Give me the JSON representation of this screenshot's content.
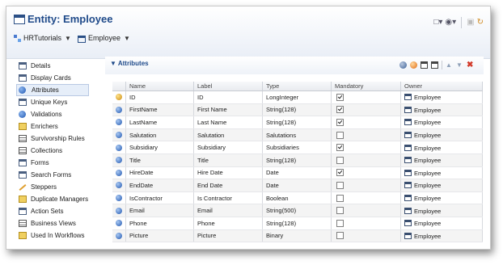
{
  "window": {
    "title": "Entity: Employee"
  },
  "breadcrumb": [
    {
      "label": "HRTutorials",
      "icon": "tree-icon"
    },
    {
      "label": "Employee",
      "icon": "entity-icon"
    }
  ],
  "toolbar": {
    "icons": [
      "new-dropdown-icon",
      "binoculars-dropdown-icon",
      "save-icon",
      "refresh-icon"
    ]
  },
  "sidebar": {
    "items": [
      {
        "label": "Details",
        "icon": "details-icon"
      },
      {
        "label": "Display Cards",
        "icon": "display-cards-icon"
      },
      {
        "label": "Attributes",
        "icon": "attributes-icon",
        "selected": true
      },
      {
        "label": "Unique Keys",
        "icon": "unique-keys-icon"
      },
      {
        "label": "Validations",
        "icon": "validations-icon"
      },
      {
        "label": "Enrichers",
        "icon": "enrichers-icon"
      },
      {
        "label": "Survivorship Rules",
        "icon": "survivorship-icon"
      },
      {
        "label": "Collections",
        "icon": "collections-icon"
      },
      {
        "label": "Forms",
        "icon": "forms-icon"
      },
      {
        "label": "Search Forms",
        "icon": "search-forms-icon"
      },
      {
        "label": "Steppers",
        "icon": "steppers-icon"
      },
      {
        "label": "Duplicate Managers",
        "icon": "duplicate-managers-icon"
      },
      {
        "label": "Action Sets",
        "icon": "action-sets-icon"
      },
      {
        "label": "Business Views",
        "icon": "business-views-icon"
      },
      {
        "label": "Used In Workflows",
        "icon": "workflows-icon"
      }
    ]
  },
  "attributes": {
    "title": "Attributes",
    "tools": [
      "add-attribute-icon",
      "add-reference-icon",
      "open-icon",
      "edit-icon",
      "move-up-icon",
      "move-down-icon",
      "delete-icon"
    ],
    "columns": [
      "Name",
      "Label",
      "Type",
      "Mandatory",
      "Owner"
    ],
    "rows": [
      {
        "name": "ID",
        "label": "ID",
        "type": "LongInteger",
        "mandatory": true,
        "owner": "Employee"
      },
      {
        "name": "FirstName",
        "label": "First Name",
        "type": "String(128)",
        "mandatory": true,
        "owner": "Employee"
      },
      {
        "name": "LastName",
        "label": "Last Name",
        "type": "String(128)",
        "mandatory": true,
        "owner": "Employee"
      },
      {
        "name": "Salutation",
        "label": "Salutation",
        "type": "Salutations",
        "mandatory": false,
        "owner": "Employee"
      },
      {
        "name": "Subsidiary",
        "label": "Subsidiary",
        "type": "Subsidiaries",
        "mandatory": true,
        "owner": "Employee"
      },
      {
        "name": "Title",
        "label": "Title",
        "type": "String(128)",
        "mandatory": false,
        "owner": "Employee"
      },
      {
        "name": "HireDate",
        "label": "Hire Date",
        "type": "Date",
        "mandatory": true,
        "owner": "Employee"
      },
      {
        "name": "EndDate",
        "label": "End Date",
        "type": "Date",
        "mandatory": false,
        "owner": "Employee"
      },
      {
        "name": "IsContractor",
        "label": "Is Contractor",
        "type": "Boolean",
        "mandatory": false,
        "owner": "Employee"
      },
      {
        "name": "Email",
        "label": "Email",
        "type": "String(500)",
        "mandatory": false,
        "owner": "Employee"
      },
      {
        "name": "Phone",
        "label": "Phone",
        "type": "String(128)",
        "mandatory": false,
        "owner": "Employee"
      },
      {
        "name": "Picture",
        "label": "Picture",
        "type": "Binary",
        "mandatory": false,
        "owner": "Employee"
      }
    ]
  }
}
